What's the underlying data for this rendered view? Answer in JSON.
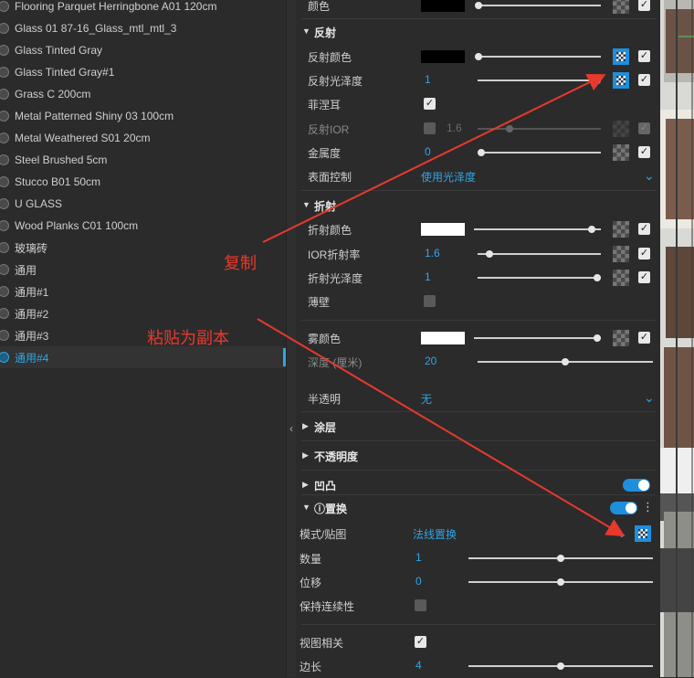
{
  "materials": [
    {
      "name": "Flooring Parquet Herringbone A01 120cm"
    },
    {
      "name": "Glass 01 87-16_Glass_mtl_mtl_3"
    },
    {
      "name": "Glass Tinted Gray"
    },
    {
      "name": "Glass Tinted Gray#1"
    },
    {
      "name": "Grass C 200cm"
    },
    {
      "name": "Metal Patterned Shiny 03 100cm"
    },
    {
      "name": "Metal Weathered S01 20cm"
    },
    {
      "name": "Steel Brushed 5cm"
    },
    {
      "name": "Stucco B01 50cm"
    },
    {
      "name": "U GLASS"
    },
    {
      "name": "Wood Planks C01 100cm"
    },
    {
      "name": "玻璃砖"
    },
    {
      "name": "通用"
    },
    {
      "name": "通用#1"
    },
    {
      "name": "通用#2"
    },
    {
      "name": "通用#3"
    },
    {
      "name": "通用#4"
    }
  ],
  "selected_material": "通用#4",
  "props": {
    "color_label": "颜色",
    "reflection_title": "反射",
    "refl_color_label": "反射颜色",
    "refl_gloss_label": "反射光泽度",
    "refl_gloss_value": "1",
    "fresnel_label": "菲涅耳",
    "refl_ior_label": "反射IOR",
    "refl_ior_value": "1.6",
    "metalness_label": "金属度",
    "metalness_value": "0",
    "surface_label": "表面控制",
    "surface_value": "使用光泽度",
    "refraction_title": "折射",
    "refr_color_label": "折射颜色",
    "ior_label": "IOR折射率",
    "ior_value": "1.6",
    "refr_gloss_label": "折射光泽度",
    "refr_gloss_value": "1",
    "thin_label": "薄壁",
    "fog_color_label": "雾颜色",
    "depth_label": "深度 (厘米)",
    "depth_value": "20",
    "translucency_label": "半透明",
    "translucency_value": "无",
    "coat_title": "涂层",
    "opacity_title": "不透明度",
    "bump_title": "凹凸",
    "displace_title": "置换",
    "mode_label": "模式/贴图",
    "mode_value": "法线置换",
    "amount_label": "数量",
    "amount_value": "1",
    "shift_label": "位移",
    "shift_value": "0",
    "keep_cont_label": "保持连续性",
    "view_dep_label": "视图相关",
    "edge_len_label": "边长",
    "edge_len_value": "4"
  },
  "annotations": {
    "copy": "复制",
    "paste": "粘贴为副本"
  },
  "colors": {
    "accent": "#2fa6e6",
    "annotation": "#e8392e"
  }
}
